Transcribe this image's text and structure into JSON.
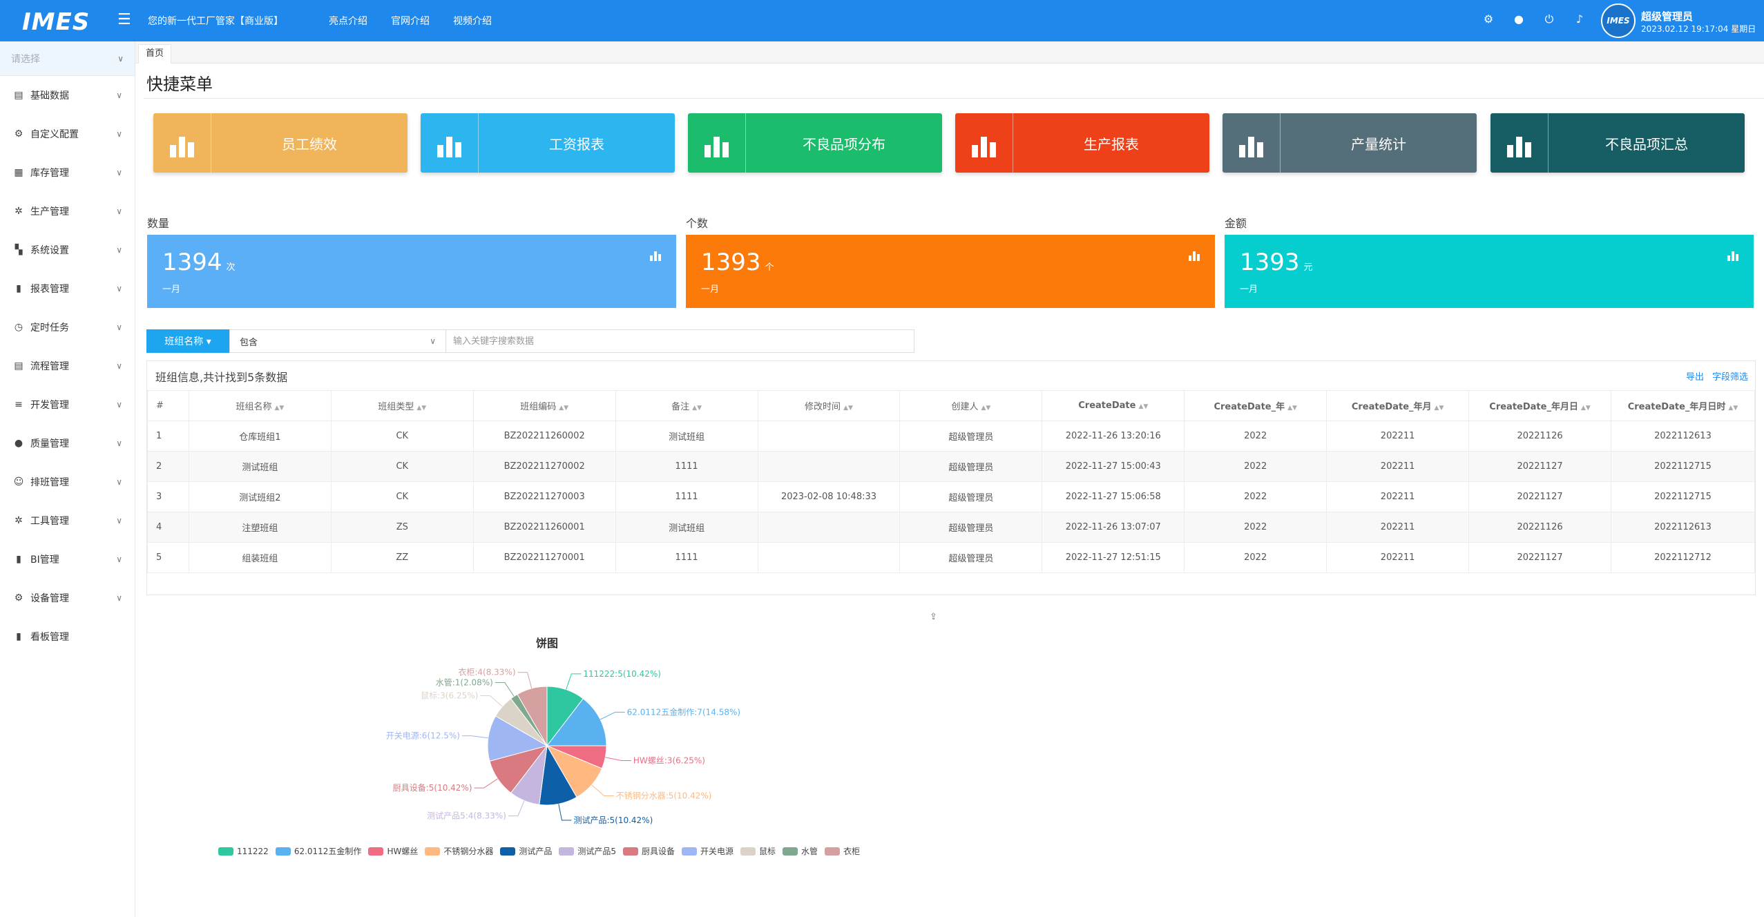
{
  "header": {
    "logo": "IMES",
    "subtitle": "您的新一代工厂管家【商业版】",
    "nav": [
      "亮点介绍",
      "官网介绍",
      "视频介绍"
    ],
    "avatar_text": "IMES",
    "user_name": "超级管理员",
    "user_time": "2023.02.12 19:17:04 星期日"
  },
  "sidebar": {
    "select_placeholder": "请选择",
    "items": [
      {
        "label": "基础数据",
        "icon": "▤"
      },
      {
        "label": "自定义配置",
        "icon": "⚙"
      },
      {
        "label": "库存管理",
        "icon": "▦"
      },
      {
        "label": "生产管理",
        "icon": "✲"
      },
      {
        "label": "系统设置",
        "icon": "▚"
      },
      {
        "label": "报表管理",
        "icon": "▮"
      },
      {
        "label": "定时任务",
        "icon": "◷"
      },
      {
        "label": "流程管理",
        "icon": "▤"
      },
      {
        "label": "开发管理",
        "icon": "≡"
      },
      {
        "label": "质量管理",
        "icon": "●"
      },
      {
        "label": "排班管理",
        "icon": "☺"
      },
      {
        "label": "工具管理",
        "icon": "✲"
      },
      {
        "label": "BI管理",
        "icon": "▮"
      },
      {
        "label": "设备管理",
        "icon": "⚙"
      },
      {
        "label": "看板管理",
        "icon": "▮"
      }
    ]
  },
  "tabs": {
    "home": "首页"
  },
  "page": {
    "title": "快捷菜单"
  },
  "quick_menu": [
    {
      "label": "员工绩效",
      "color": "#f0b45a"
    },
    {
      "label": "工资报表",
      "color": "#2db5ef"
    },
    {
      "label": "不良品项分布",
      "color": "#1bbd6c"
    },
    {
      "label": "生产报表",
      "color": "#ee4019"
    },
    {
      "label": "产量统计",
      "color": "#546e7a"
    },
    {
      "label": "不良品项汇总",
      "color": "#165e64"
    }
  ],
  "stats": [
    {
      "label": "数量",
      "value": "1394",
      "unit": "次",
      "sub": "一月",
      "color": "#5aaff7"
    },
    {
      "label": "个数",
      "value": "1393",
      "unit": "个",
      "sub": "一月",
      "color": "#fc7a09"
    },
    {
      "label": "金额",
      "value": "1393",
      "unit": "元",
      "sub": "一月",
      "color": "#06cecf"
    }
  ],
  "search": {
    "field": "班组名称 ▾",
    "operator": "包含",
    "placeholder": "输入关键字搜索数据"
  },
  "table": {
    "caption": "班组信息,共计找到5条数据",
    "actions": [
      "导出",
      "字段筛选"
    ],
    "columns": [
      "#",
      "班组名称",
      "班组类型",
      "班组编码",
      "备注",
      "修改时间",
      "创建人",
      "CreateDate",
      "CreateDate_年",
      "CreateDate_年月",
      "CreateDate_年月日",
      "CreateDate_年月日时"
    ],
    "rows": [
      [
        "1",
        "仓库班组1",
        "CK",
        "BZ202211260002",
        "测试班组",
        "",
        "超级管理员",
        "2022-11-26 13:20:16",
        "2022",
        "202211",
        "20221126",
        "2022112613"
      ],
      [
        "2",
        "测试班组",
        "CK",
        "BZ202211270002",
        "1111",
        "",
        "超级管理员",
        "2022-11-27 15:00:43",
        "2022",
        "202211",
        "20221127",
        "2022112715"
      ],
      [
        "3",
        "测试班组2",
        "CK",
        "BZ202211270003",
        "1111",
        "2023-02-08 10:48:33",
        "超级管理员",
        "2022-11-27 15:06:58",
        "2022",
        "202211",
        "20221127",
        "2022112715"
      ],
      [
        "4",
        "注塑班组",
        "ZS",
        "BZ202211260001",
        "测试班组",
        "",
        "超级管理员",
        "2022-11-26 13:07:07",
        "2022",
        "202211",
        "20221126",
        "2022112613"
      ],
      [
        "5",
        "组装班组",
        "ZZ",
        "BZ202211270001",
        "1111",
        "",
        "超级管理员",
        "2022-11-27 12:51:15",
        "2022",
        "202211",
        "20221127",
        "2022112712"
      ]
    ]
  },
  "chart_data": {
    "type": "pie",
    "title": "饼图",
    "legend_position": "bottom",
    "slices": [
      {
        "name": "111222",
        "value": 5,
        "label": "111222:5(10.42%)",
        "color": "#2ec7a0"
      },
      {
        "name": "62.0112五金制作",
        "value": 7,
        "label": "62.0112五金制作:7(14.58%)",
        "color": "#5ab1ef"
      },
      {
        "name": "HW螺丝",
        "value": 3,
        "label": "HW螺丝:3(6.25%)",
        "color": "#f06c83"
      },
      {
        "name": "不锈钢分水器",
        "value": 5,
        "label": "不锈钢分水器:5(10.42%)",
        "color": "#ffb980"
      },
      {
        "name": "测试产品",
        "value": 5,
        "label": "测试产品:5(10.42%)",
        "color": "#0d5fa8"
      },
      {
        "name": "测试产品5",
        "value": 4,
        "label": "测试产品5:4(8.33%)",
        "color": "#c5b6df"
      },
      {
        "name": "厨具设备",
        "value": 5,
        "label": "厨具设备:5(10.42%)",
        "color": "#d87a80"
      },
      {
        "name": "开关电源",
        "value": 6,
        "label": "开关电源:6(12.5%)",
        "color": "#9fb6f4"
      },
      {
        "name": "鼠标",
        "value": 3,
        "label": "鼠标:3(6.25%)",
        "color": "#dcd3c8"
      },
      {
        "name": "水管",
        "value": 1,
        "label": "水管:1(2.08%)",
        "color": "#7fa98e"
      },
      {
        "name": "衣柜",
        "value": 4,
        "label": "衣柜:4(8.33%)",
        "color": "#d5a0a0"
      }
    ]
  }
}
